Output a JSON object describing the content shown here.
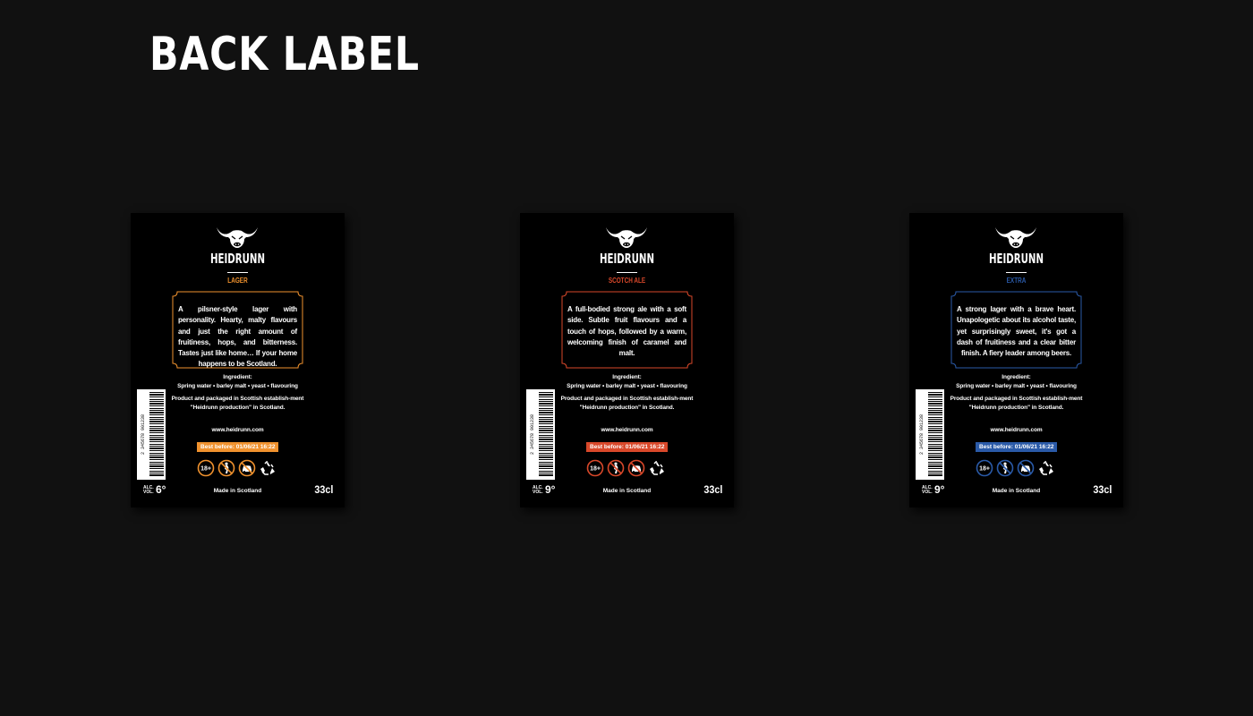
{
  "page": {
    "title": "BACK LABEL"
  },
  "labels": [
    {
      "brand": "HEIDRUNN",
      "variety": "LAGER",
      "accent": "#f0922e",
      "description": "A pilsner-style lager with personality. Hearty, malty flavours and just the right amount of fruitiness, hops, and bitterness. Tastes just like home… If your home happens to be Scotland.",
      "ingredients_title": "Ingredient:",
      "ingredients": "Spring water • barley malt • yeast • flavouring",
      "production": "Product and packaged in Scottish establish-ment \"Heidrunn production\" in Scotland.",
      "website": "www.heidrunn.com",
      "best_before": "Best before: 01/06/21 16:22",
      "barcode_number": "2 345678 901238",
      "alc_label": "ALC. VOL.",
      "abv": "6°",
      "made_in": "Made in Scotland",
      "volume": "33cl",
      "icons": [
        "age-18-icon",
        "pregnancy-warning-icon",
        "no-drink-driving-icon",
        "recycle-icon"
      ]
    },
    {
      "brand": "HEIDRUNN",
      "variety": "SCOTCH ALE",
      "accent": "#d9482a",
      "description": "A full-bodied strong ale with a soft side. Subtle fruit flavours and a touch of hops, followed by a warm, welcoming finish of caramel and malt.",
      "ingredients_title": "Ingredient:",
      "ingredients": "Spring water • barley malt • yeast • flavouring",
      "production": "Product and packaged in Scottish establish-ment \"Heidrunn production\" in Scotland.",
      "website": "www.heidrunn.com",
      "best_before": "Best before: 01/06/21 16:22",
      "barcode_number": "2 345678 901238",
      "alc_label": "ALC. VOL.",
      "abv": "9°",
      "made_in": "Made in Scotland",
      "volume": "33cl",
      "icons": [
        "age-18-icon",
        "pregnancy-warning-icon",
        "no-drink-driving-icon",
        "recycle-icon"
      ]
    },
    {
      "brand": "HEIDRUNN",
      "variety": "EXTRA",
      "accent": "#2a5aa8",
      "description": "A strong lager with a brave heart. Unapologetic about its alcohol taste, yet surprisingly sweet, it's got a dash of fruitiness and a clear bitter finish. A fiery leader among beers.",
      "ingredients_title": "Ingredient:",
      "ingredients": "Spring water • barley malt • yeast • flavouring",
      "production": "Product and packaged in Scottish establish-ment \"Heidrunn production\" in Scotland.",
      "website": "www.heidrunn.com",
      "best_before": "Best before: 01/06/21 16:22",
      "barcode_number": "2 345678 901238",
      "alc_label": "ALC. VOL.",
      "abv": "9°",
      "made_in": "Made in Scotland",
      "volume": "33cl",
      "icons": [
        "age-18-icon",
        "pregnancy-warning-icon",
        "no-drink-driving-icon",
        "recycle-icon"
      ]
    }
  ]
}
